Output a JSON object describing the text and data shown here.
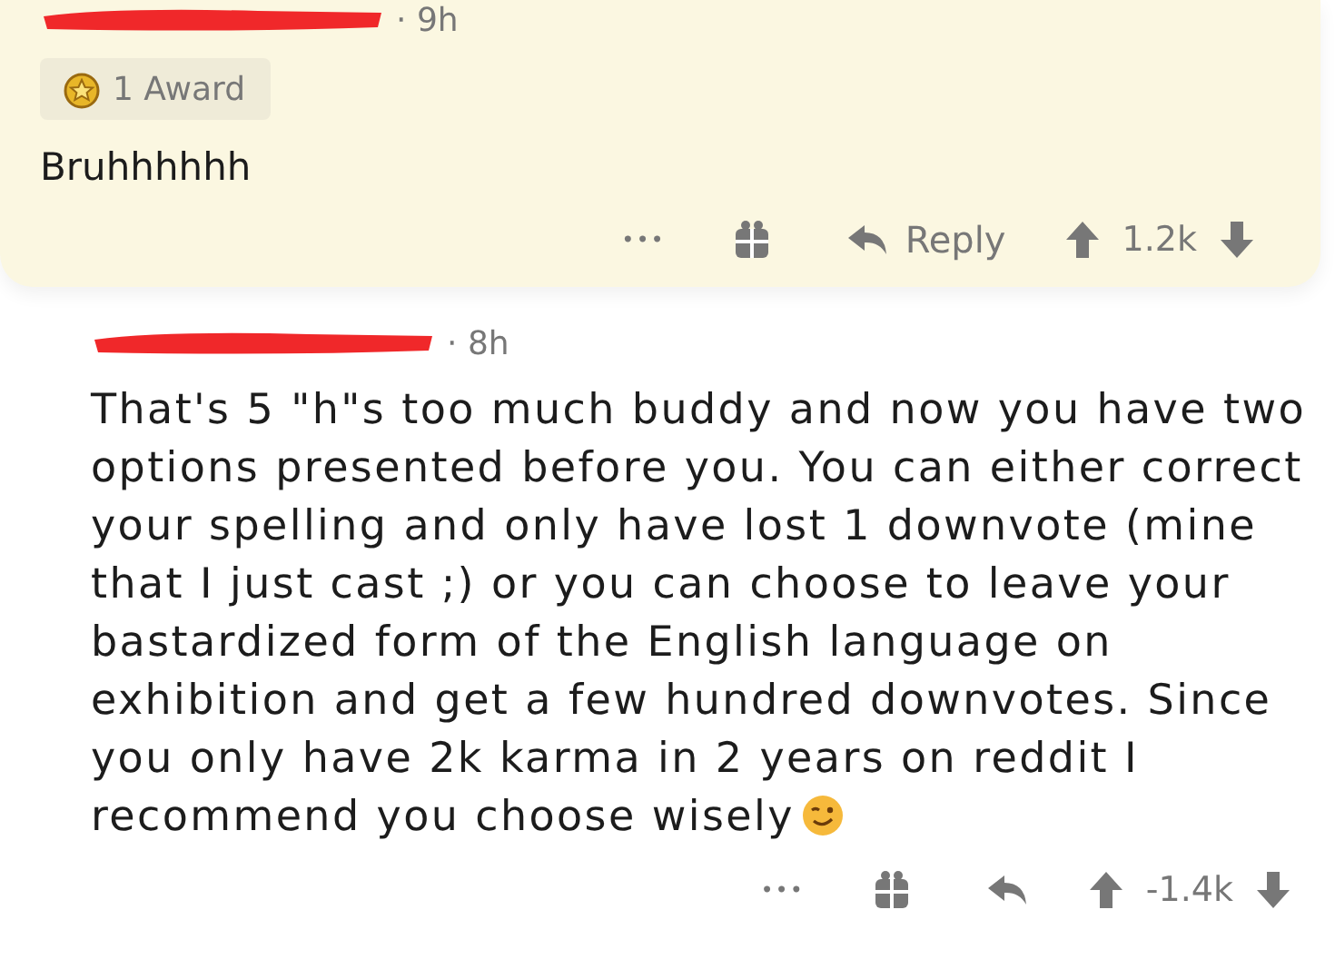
{
  "comments": [
    {
      "time": "· 9h",
      "highlighted": true,
      "award": "1 Award",
      "body": "Bruhhhhhh",
      "trailing_emoji": false,
      "more": "•••",
      "reply": "Reply",
      "score": "1.2k"
    },
    {
      "time": "· 8h",
      "highlighted": false,
      "body": "That's 5 \"h\"s too much buddy and now you have two options presented before you. You can either correct your spelling and only have lost 1 downvote (mine that I just cast ;) or you can choose to leave your bastardized form of the English language on exhibition and get a few hundred downvotes. Since you only have 2k karma in 2 years on reddit I recommend you choose wisely",
      "trailing_emoji": true,
      "more": "•••",
      "score": "-1.4k"
    }
  ]
}
